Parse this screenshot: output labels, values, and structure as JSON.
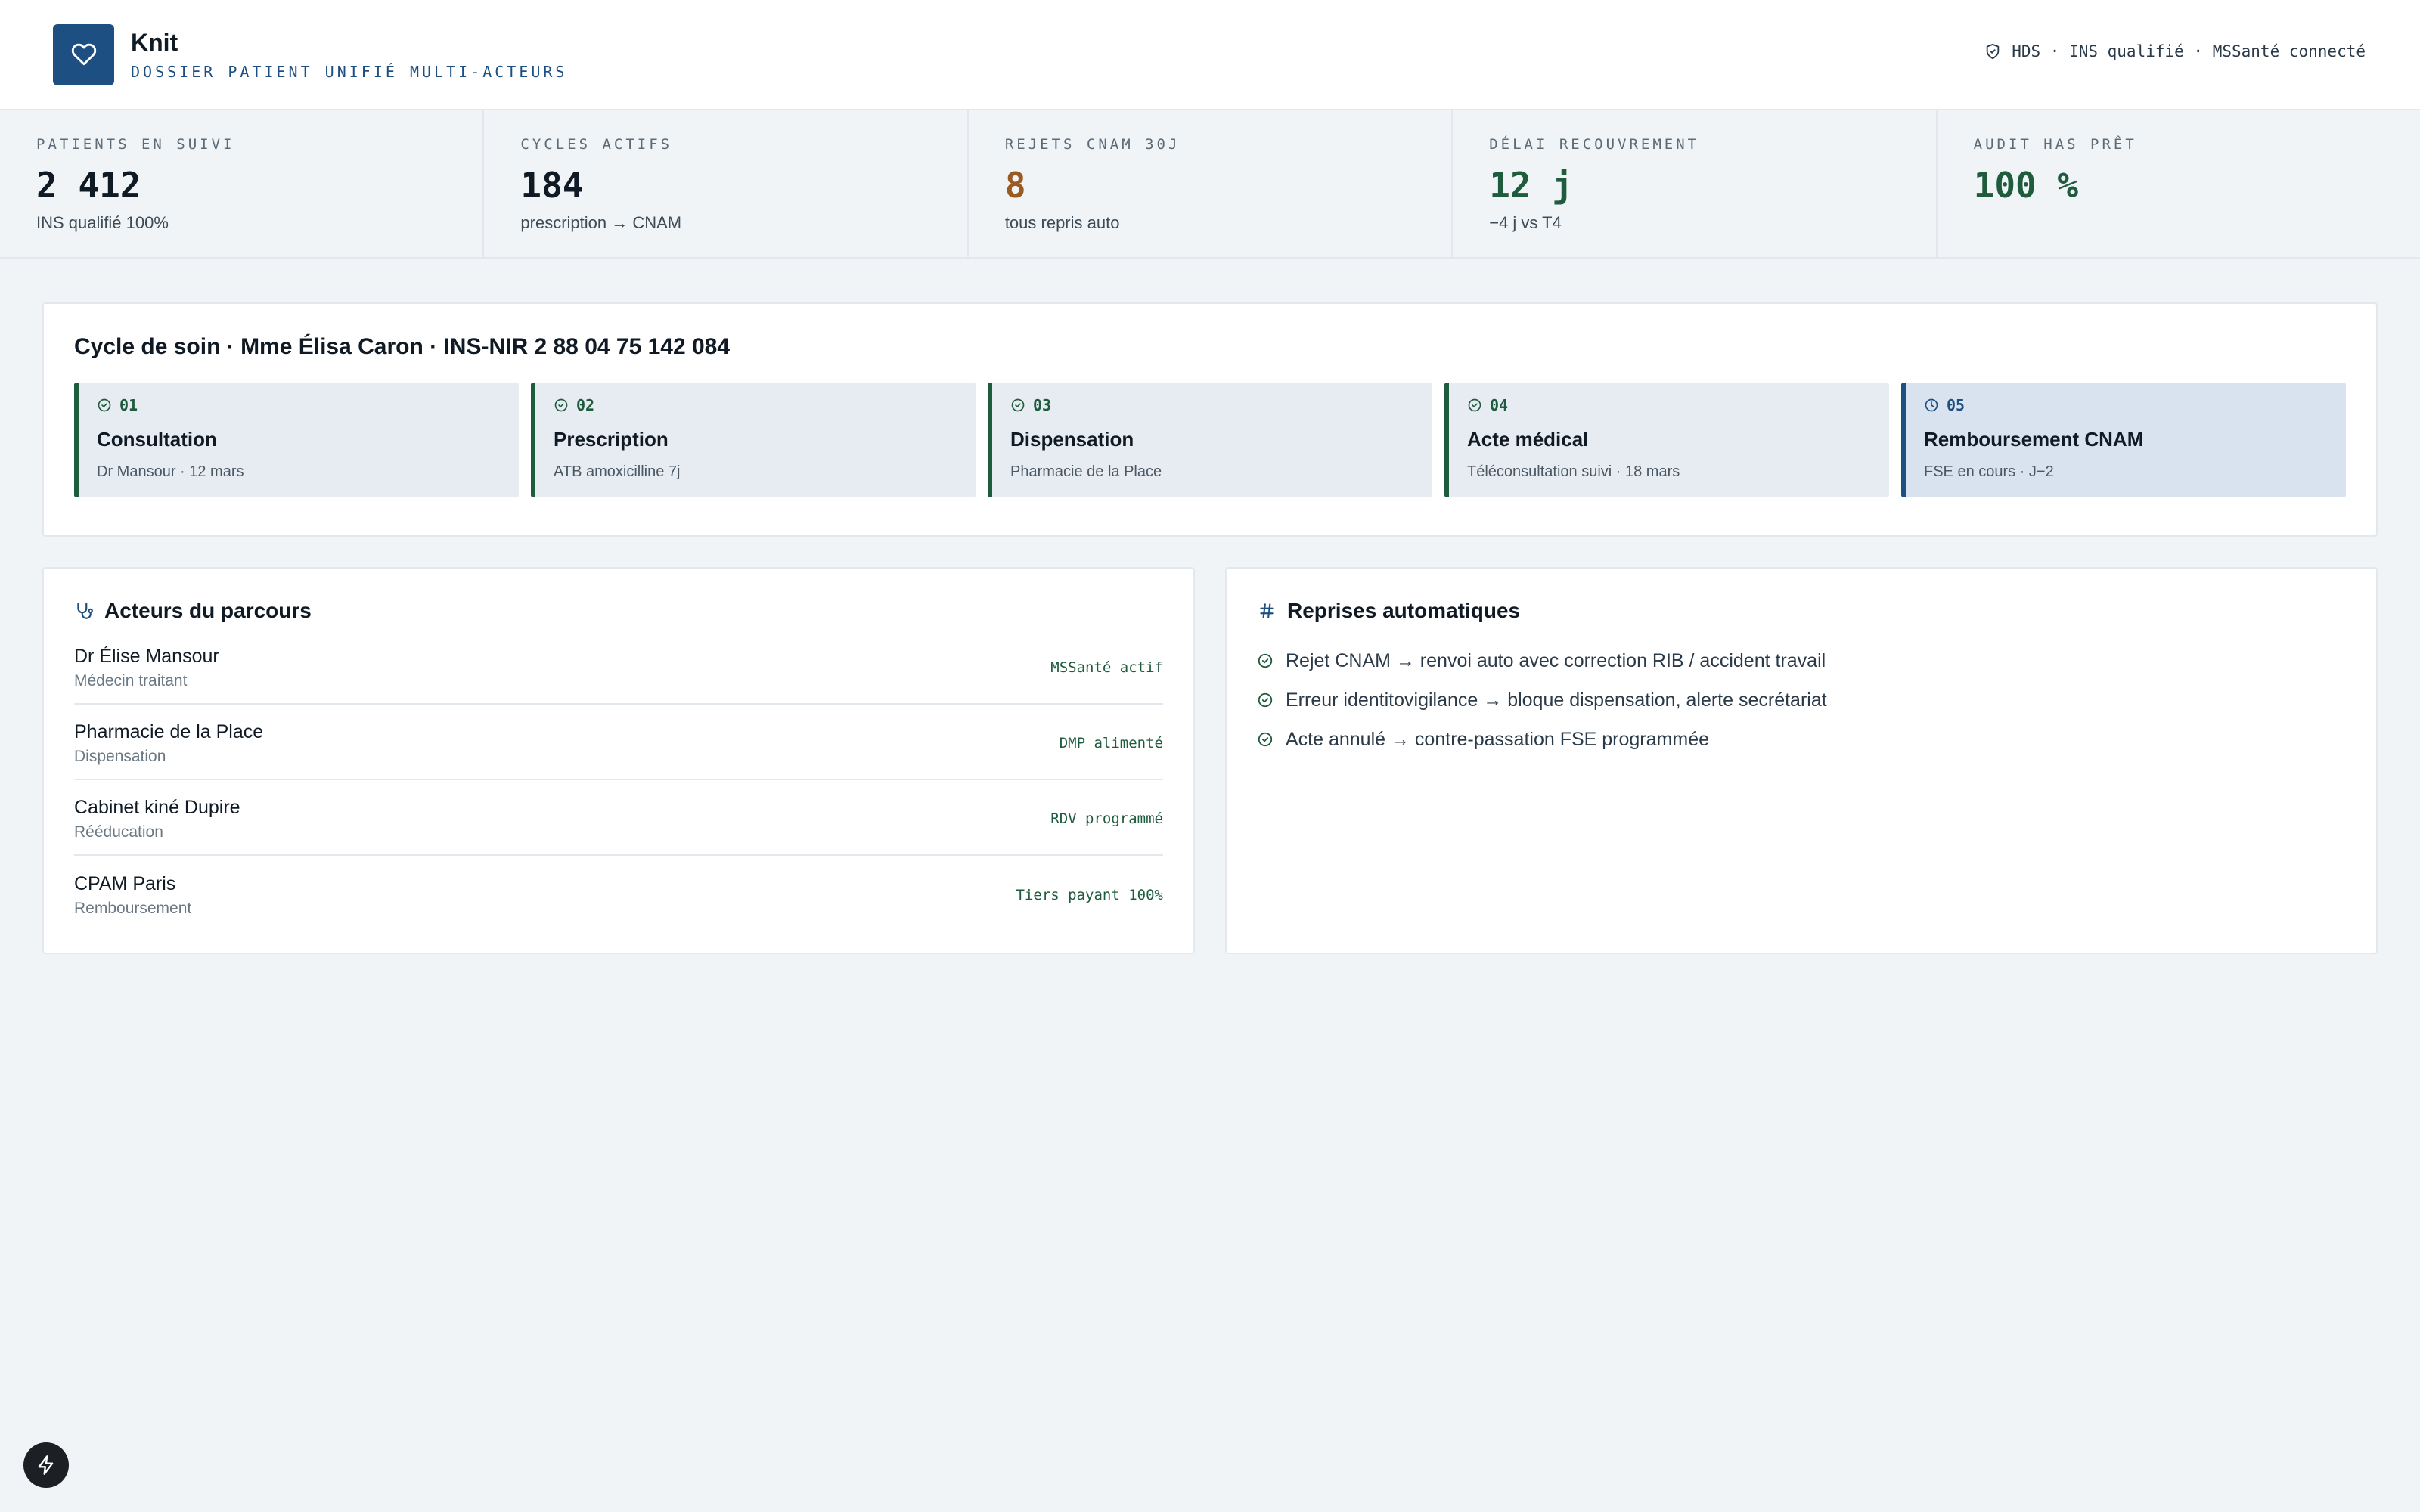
{
  "colors": {
    "brand": "#1d4f82",
    "success": "#1f5b3d",
    "warning": "#9a5a24",
    "background": "#f0f4f7"
  },
  "header": {
    "app_name": "Knit",
    "subtitle": "DOSSIER PATIENT UNIFIÉ MULTI-ACTEURS",
    "logo_icon": "heart-icon",
    "status_icon": "shield-check-icon",
    "status": "HDS · INS qualifié · MSSanté connecté"
  },
  "kpis": [
    {
      "label": "PATIENTS EN SUIVI",
      "value": "2 412",
      "sub": "INS qualifié 100%",
      "tone": "default"
    },
    {
      "label": "CYCLES ACTIFS",
      "value": "184",
      "sub": "prescription → CNAM",
      "tone": "default"
    },
    {
      "label": "REJETS CNAM 30J",
      "value": "8",
      "sub": "tous repris auto",
      "tone": "warning"
    },
    {
      "label": "DÉLAI RECOUVREMENT",
      "value": "12 j",
      "sub": "−4 j vs T4",
      "tone": "success"
    },
    {
      "label": "AUDIT HAS PRÊT",
      "value": "100 %",
      "sub": "",
      "tone": "success"
    }
  ],
  "cycle": {
    "title": "Cycle de soin · Mme Élisa Caron · INS-NIR 2 88 04 75 142 084",
    "steps": [
      {
        "num": "01",
        "title": "Consultation",
        "sub": "Dr Mansour · 12 mars",
        "status": "done"
      },
      {
        "num": "02",
        "title": "Prescription",
        "sub": "ATB amoxicilline 7j",
        "status": "done"
      },
      {
        "num": "03",
        "title": "Dispensation",
        "sub": "Pharmacie de la Place",
        "status": "done"
      },
      {
        "num": "04",
        "title": "Acte médical",
        "sub": "Téléconsultation suivi · 18 mars",
        "status": "done"
      },
      {
        "num": "05",
        "title": "Remboursement CNAM",
        "sub": "FSE en cours · J−2",
        "status": "current"
      }
    ]
  },
  "actors": {
    "title": "Acteurs du parcours",
    "icon": "stethoscope-icon",
    "items": [
      {
        "name": "Dr Élise Mansour",
        "role": "Médecin traitant",
        "status": "MSSanté actif"
      },
      {
        "name": "Pharmacie de la Place",
        "role": "Dispensation",
        "status": "DMP alimenté"
      },
      {
        "name": "Cabinet kiné Dupire",
        "role": "Rééducation",
        "status": "RDV programmé"
      },
      {
        "name": "CPAM Paris",
        "role": "Remboursement",
        "status": "Tiers payant 100%"
      }
    ]
  },
  "auto": {
    "title": "Reprises automatiques",
    "icon": "hash-icon",
    "items": [
      "Rejet CNAM → renvoi auto avec correction RIB / accident travail",
      "Erreur identitovigilance → bloque dispensation, alerte secrétariat",
      "Acte annulé → contre-passation FSE programmée"
    ]
  },
  "fab_icon": "lightning-icon"
}
